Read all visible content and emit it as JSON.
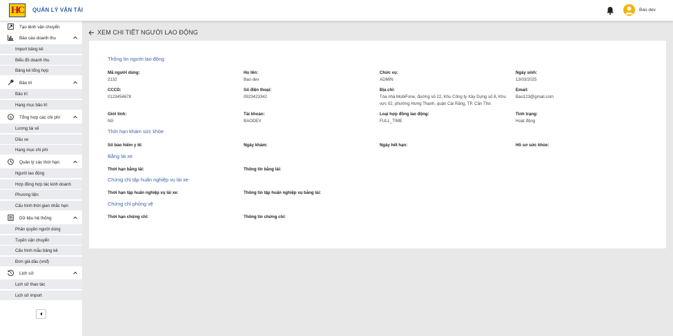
{
  "header": {
    "app_title": "QUẢN LÝ VẬN TẢI",
    "username": "Bao dev",
    "logo_text": "HC"
  },
  "sidebar": {
    "items": [
      {
        "label": "Tạo lệnh vận chuyển",
        "icon": "truck-order-icon"
      },
      {
        "label": "Báo cáo doanh thu",
        "icon": "bar-chart-icon",
        "children": [
          "Import bảng kê",
          "Biểu đồ doanh thu",
          "Bảng kê tổng hợp"
        ]
      },
      {
        "label": "Bảo trì",
        "icon": "wrench-icon",
        "children": [
          "Bảo trì",
          "Hạng mục bảo trì"
        ]
      },
      {
        "label": "Tổng hợp các chi phí",
        "icon": "dollar-icon",
        "children": [
          "Lương tài xế",
          "Dầu xe",
          "Hạng mục chi phí"
        ]
      },
      {
        "label": "Quản lý các thời hạn",
        "icon": "clock-icon",
        "children": [
          "Người lao động",
          "Hợp đồng hợp tác kinh doanh",
          "Phương tiện",
          "Cấu hình thời gian nhắc hạn"
        ]
      },
      {
        "label": "Dữ liệu hệ thống",
        "icon": "list-icon",
        "children": [
          "Phân quyền người dùng",
          "Tuyến vận chuyển",
          "Cấu hình mẫu bảng kê",
          "Đơn giá dầu (vnđ)"
        ]
      },
      {
        "label": "Lịch sử",
        "icon": "history-icon",
        "children": [
          "Lịch sử thao tác",
          "Lịch sử import"
        ]
      }
    ]
  },
  "page": {
    "title": "XEM CHI TIẾT NGƯỜI LAO ĐỘNG"
  },
  "worker_info": {
    "section_title": "Thông tin người lao động",
    "user_code_label": "Mã người dùng:",
    "user_code": "2132",
    "full_name_label": "Họ tên:",
    "full_name": "Bao dev",
    "position_label": "Chức vụ:",
    "position": "ADMIN",
    "birthdate_label": "Ngày sinh:",
    "birthdate": "13/03/2025",
    "id_card_label": "CCCD:",
    "id_card": "0123454678",
    "phone_label": "Số điện thoại:",
    "phone": "0923423342",
    "address_label": "Địa chỉ:",
    "address": "Tòa nhà MobiFone, đường số 22, Khu Công ty Xây Dựng số 8, Khu vực 02, phường Hưng Thạnh, quận Cái Răng, TP. Cần Thơ.",
    "email_label": "Email:",
    "email": "Bao123@gmail.com",
    "gender_label": "Giới tính:",
    "gender": "Nữ",
    "account_label": "Tài khoản:",
    "account": "BAODEV",
    "contract_type_label": "Loại hợp đồng lao động:",
    "contract_type": "FULL_TIME",
    "status_label": "Tình trạng:",
    "status": "Hoạt động"
  },
  "health_check": {
    "section_title": "Thời hạn khám sức khỏe",
    "insurance_label": "Số bảo hiểm y tế:",
    "exam_date_label": "Ngày khám:",
    "expiry_label": "Ngày hết hạn:",
    "record_label": "Hồ sơ sức khỏe:"
  },
  "license": {
    "section_title": "Bằng lái xe",
    "expiry_label": "Thời hạn bằng lái:",
    "info_label": "Thông tin bằng lái:"
  },
  "training_cert": {
    "section_title": "Chứng chỉ tập huấn nghiệp vụ lái xe",
    "expiry_label": "Thời hạn tập huấn nghiệp vụ lái xe:",
    "info_label": "Thông tin tập huấn nghiệp vụ bằng lái:"
  },
  "fire_cert": {
    "section_title": "Chứng chỉ phòng vệ",
    "expiry_label": "Thời hạn chứng chỉ:",
    "info_label": "Thông tin chứng chỉ:"
  },
  "colors": {
    "accent": "#3a63ad",
    "sidebar_sub_bg": "#e9ebee",
    "avatar": "#f4b400"
  }
}
